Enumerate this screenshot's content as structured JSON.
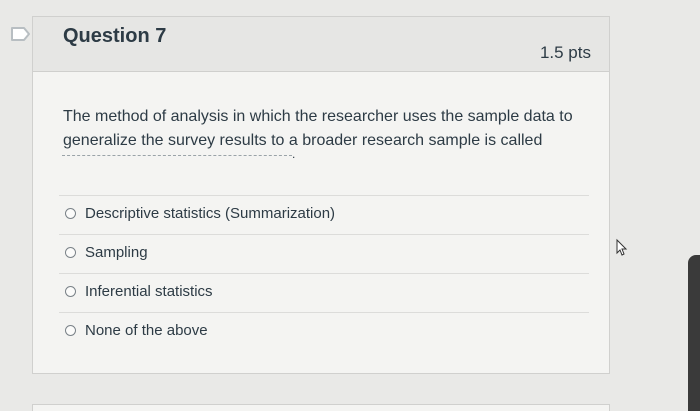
{
  "question": {
    "title": "Question 7",
    "points": "1.5 pts",
    "text": "The method of analysis in which the researcher uses the sample data to generalize the survey results to a broader research sample is called",
    "blank_suffix": "."
  },
  "answers": [
    {
      "label": "Descriptive statistics (Summarization)"
    },
    {
      "label": "Sampling"
    },
    {
      "label": "Inferential statistics"
    },
    {
      "label": "None of the above"
    }
  ],
  "icons": {
    "flag": "bookmark-flag-icon",
    "cursor": "mouse-pointer-icon"
  },
  "colors": {
    "text": "#2d3b45",
    "background": "#e9e9e7",
    "card": "#f4f4f2",
    "header": "#e6e6e4"
  }
}
